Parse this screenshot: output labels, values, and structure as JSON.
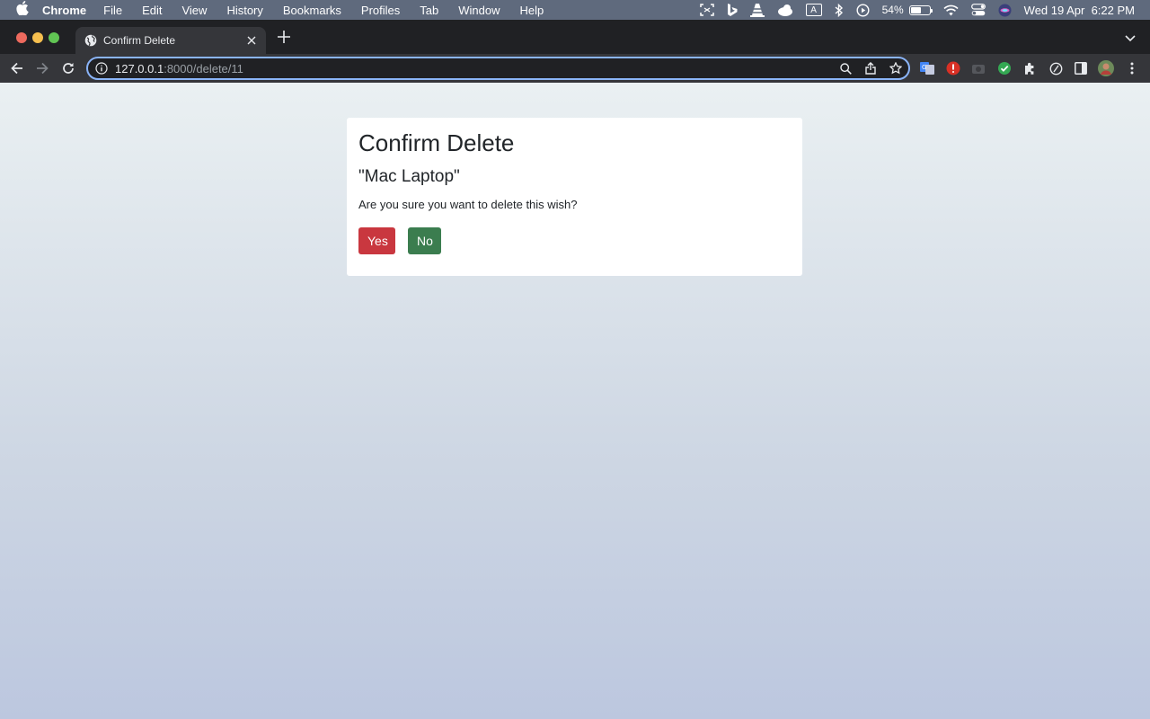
{
  "menubar": {
    "app_name": "Chrome",
    "items": [
      "File",
      "Edit",
      "View",
      "History",
      "Bookmarks",
      "Profiles",
      "Tab",
      "Window",
      "Help"
    ],
    "battery_percent": "54%",
    "battery_level": 0.54,
    "datetime": "Wed 19 Apr  6:22 PM",
    "input_indicator": "A"
  },
  "browser": {
    "tab_title": "Confirm Delete",
    "url_host": "127.0.0.1",
    "url_rest": ":8000/delete/11",
    "traffic_colors": [
      "#ed6a5e",
      "#f5bf4f",
      "#61c554"
    ]
  },
  "page": {
    "heading": "Confirm Delete",
    "item_name": "\"Mac Laptop\"",
    "message": "Are you sure you want to delete this wish?",
    "yes_label": "Yes",
    "no_label": "No",
    "colors": {
      "yes": "#c9373f",
      "no": "#3b7d4f"
    }
  }
}
